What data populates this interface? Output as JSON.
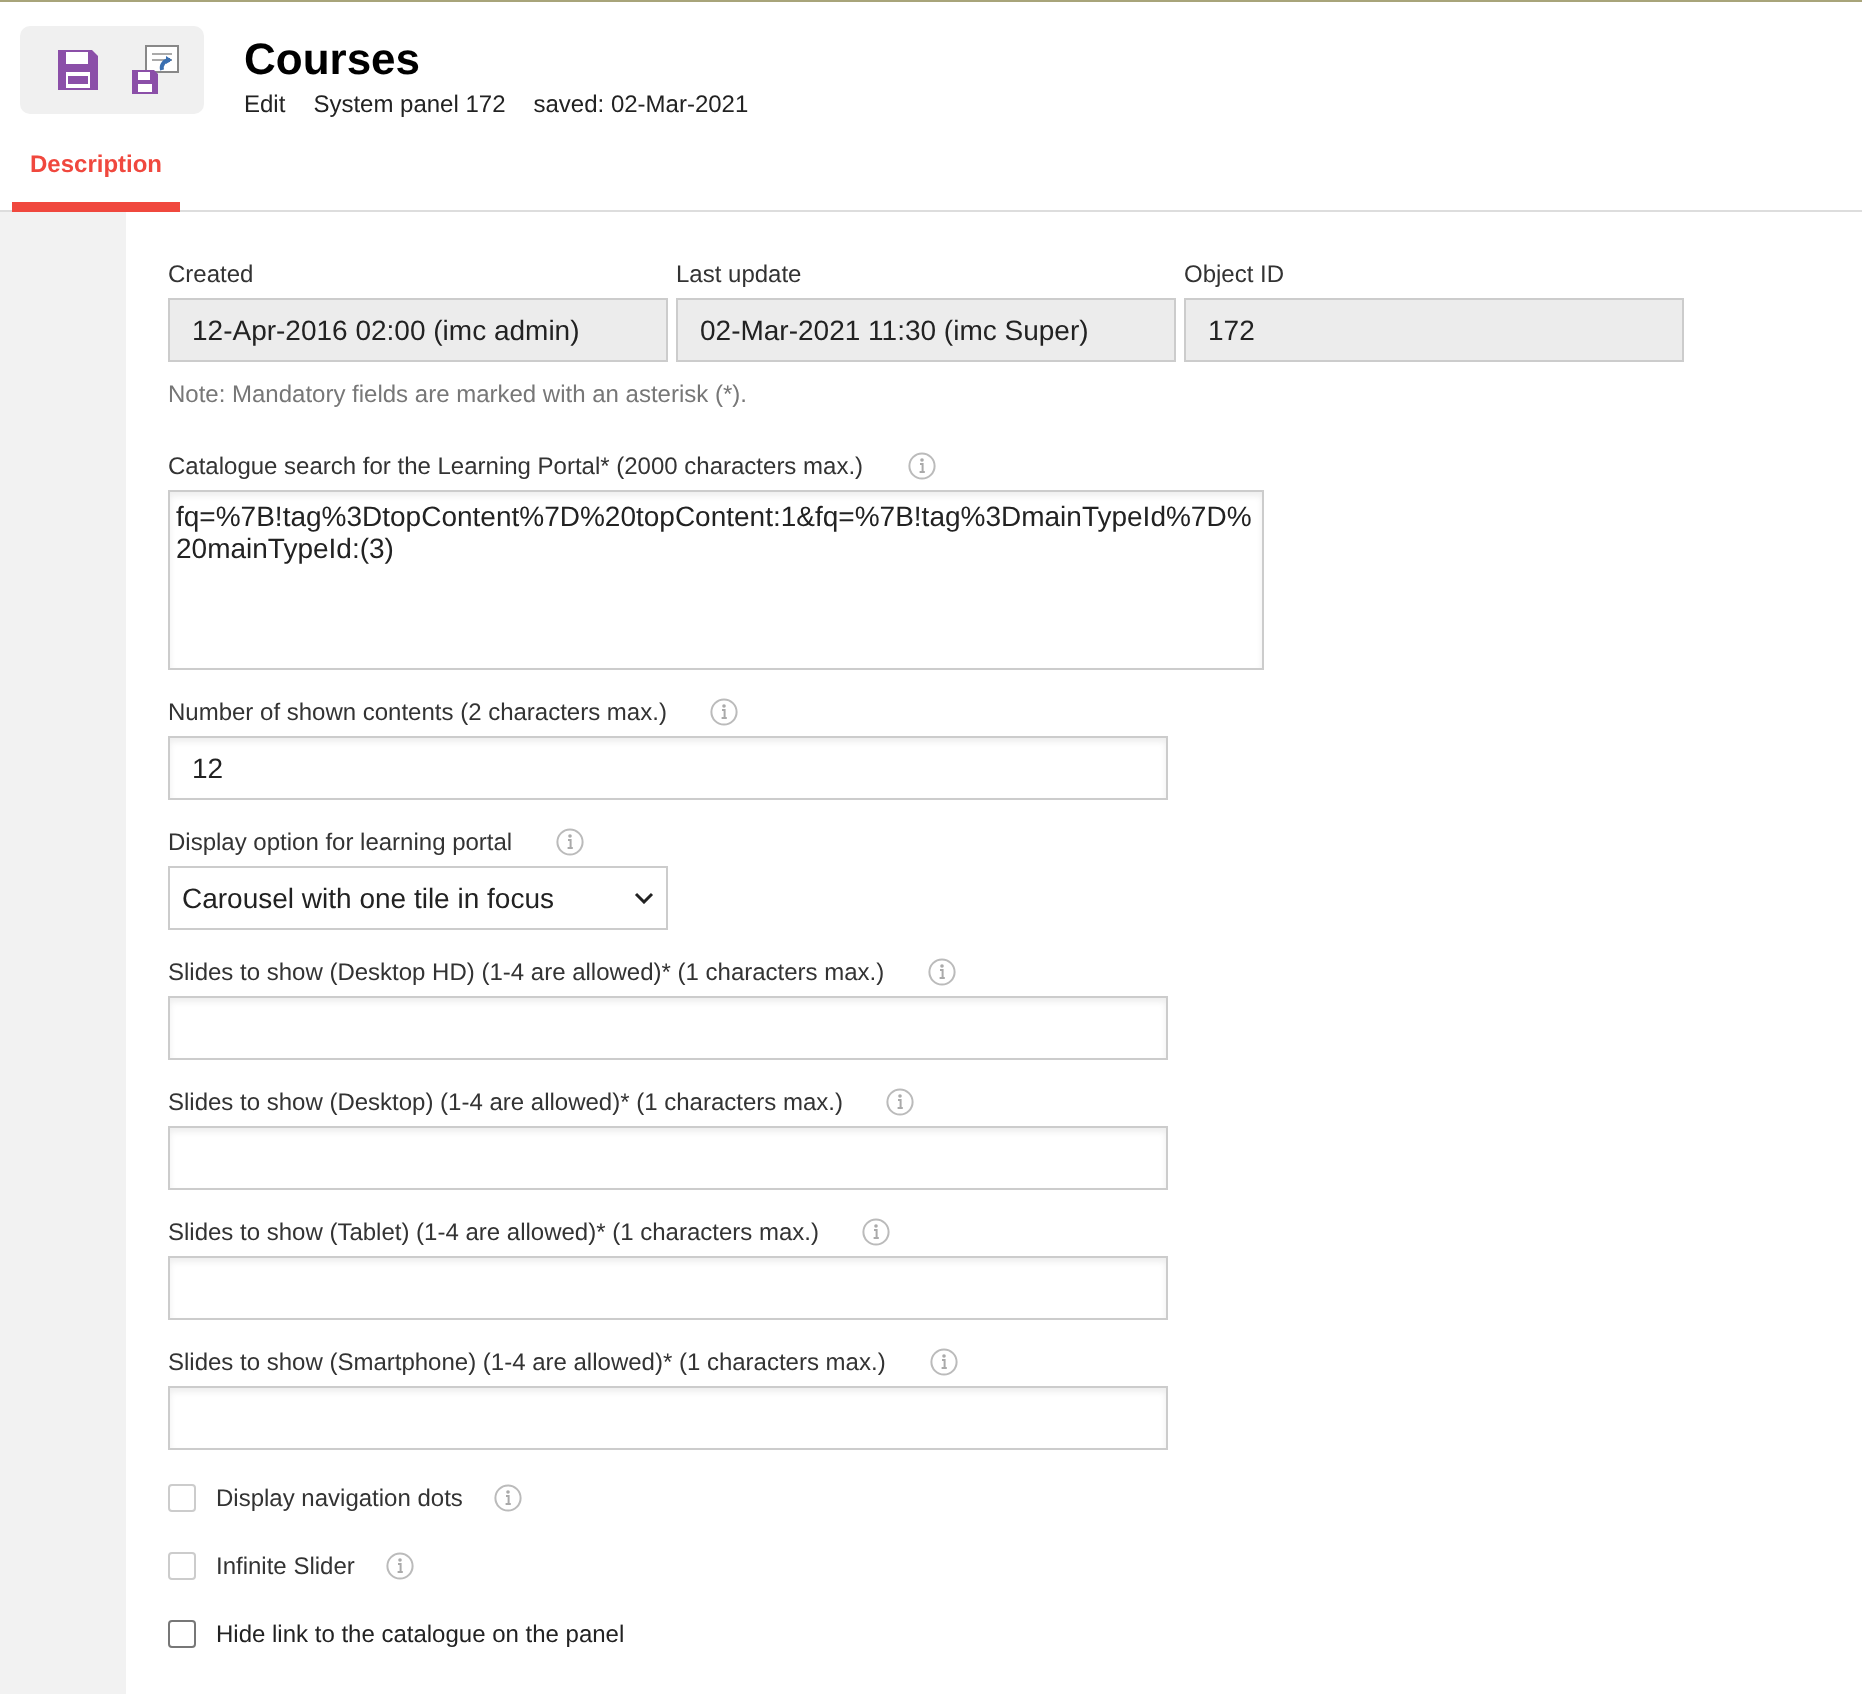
{
  "header": {
    "title": "Courses",
    "meta": [
      "Edit",
      "System panel 172",
      "saved: 02-Mar-2021"
    ]
  },
  "tabs": [
    {
      "label": "Description",
      "selected": true
    }
  ],
  "info_fields": [
    {
      "label": "Created",
      "value": "12-Apr-2016 02:00 (imc admin)"
    },
    {
      "label": "Last update",
      "value": "02-Mar-2021 11:30 (imc Super)"
    },
    {
      "label": "Object ID",
      "value": "172"
    }
  ],
  "note": "Note: Mandatory fields are marked with an asterisk (*).",
  "fields": [
    {
      "kind": "textarea",
      "label": "Catalogue search for the Learning Portal* (2000 characters max.)",
      "info": true,
      "value": "fq=%7B!tag%3DtopContent%7D%20topContent:1&fq=%7B!tag%3DmainTypeId%7D%20mainTypeId:(3)"
    },
    {
      "kind": "input",
      "label": "Number of shown contents (2 characters max.)",
      "info": true,
      "value": "12"
    },
    {
      "kind": "select",
      "label": "Display option for learning portal",
      "info": true,
      "value": "Carousel with one tile in focus"
    },
    {
      "kind": "input",
      "label": "Slides to show (Desktop HD) (1-4 are allowed)* (1 characters max.)",
      "info": true
    },
    {
      "kind": "input",
      "label": "Slides to show (Desktop) (1-4 are allowed)* (1 characters max.)",
      "info": true
    },
    {
      "kind": "input",
      "label": "Slides to show (Tablet) (1-4 are allowed)* (1 characters max.)",
      "info": true
    },
    {
      "kind": "input",
      "label": "Slides to show (Smartphone) (1-4 are allowed)* (1 characters max.)",
      "info": true
    },
    {
      "kind": "checkbox",
      "label": "Display navigation dots",
      "info": true,
      "checked": false,
      "disabled": true
    },
    {
      "kind": "checkbox",
      "label": "Infinite Slider",
      "info": true,
      "checked": false,
      "disabled": true
    },
    {
      "kind": "checkbox",
      "label": "Hide link to the catalogue on the panel",
      "checked": false,
      "disabled": false
    }
  ]
}
